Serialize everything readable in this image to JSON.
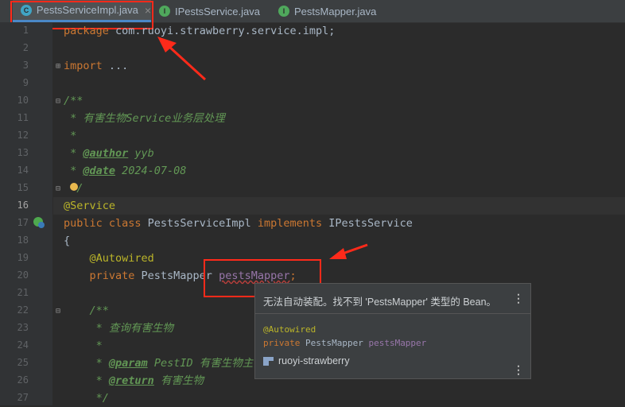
{
  "tabs": [
    {
      "label": "PestsServiceImpl.java",
      "icon": "class-icon",
      "close": "×"
    },
    {
      "label": "IPestsService.java",
      "icon": "interface-icon"
    },
    {
      "label": "PestsMapper.java",
      "icon": "interface-icon"
    }
  ],
  "lines": [
    "1",
    "2",
    "3",
    "9",
    "10",
    "11",
    "12",
    "13",
    "14",
    "15",
    "16",
    "17",
    "18",
    "19",
    "20",
    "21",
    "22",
    "23",
    "24",
    "25",
    "26",
    "27"
  ],
  "code": {
    "l1_kw": "package",
    "l1_rest": " com.ruoyi.strawberry.service.impl;",
    "l3_kw": "import",
    "l3_rest": " ...",
    "l10": "/**",
    "l11": " * 有害生物Service业务层处理",
    "l12": " *",
    "l13_a": " * ",
    "l13_tag": "@author",
    "l13_b": " yyb",
    "l14_a": " * ",
    "l14_tag": "@date",
    "l14_b": " 2024-07-08",
    "l15": "  /",
    "l16": "@Service",
    "l17_kw": "public class",
    "l17_b": " PestsServiceImpl ",
    "l17_kw2": "implements",
    "l17_c": " IPestsService",
    "l18": "{",
    "l19": "    @Autowired",
    "l20_kw": "    private",
    "l20_b": " PestsMapper ",
    "l20_fld": "pestsMapper",
    "l20_c": ";",
    "l22": "    /**",
    "l23": "     * 查询有害生物",
    "l24": "     *",
    "l25_a": "     * ",
    "l25_tag": "@param",
    "l25_b": " PestID 有害生物主键",
    "l26_a": "     * ",
    "l26_tag": "@return",
    "l26_b": " 有害生物",
    "l27": "     */"
  },
  "popup": {
    "message": "无法自动装配。找不到 'PestsMapper' 类型的 Bean。",
    "code_annotation": "@Autowired",
    "code_kw": "private",
    "code_type": " PestsMapper ",
    "code_field": "pestsMapper",
    "module": "ruoyi-strawberry",
    "menu": "⋮"
  }
}
